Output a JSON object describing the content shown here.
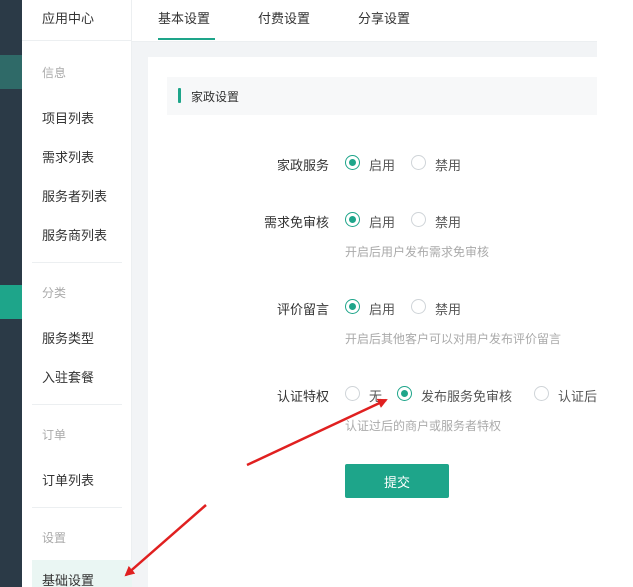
{
  "sidebar": {
    "app_title": "应用中心",
    "groups": [
      "信息",
      "分类",
      "订单",
      "设置"
    ],
    "items": [
      "项目列表",
      "需求列表",
      "服务者列表",
      "服务商列表",
      "服务类型",
      "入驻套餐",
      "订单列表",
      "基础设置"
    ]
  },
  "tabs": [
    "基本设置",
    "付费设置",
    "分享设置"
  ],
  "section_title": "家政设置",
  "rows": [
    {
      "label": "家政服务",
      "options": [
        "启用",
        "禁用"
      ],
      "selected": 0
    },
    {
      "label": "需求免审核",
      "options": [
        "启用",
        "禁用"
      ],
      "selected": 0,
      "hint": "开启后用户发布需求免审核"
    },
    {
      "label": "评价留言",
      "options": [
        "启用",
        "禁用"
      ],
      "selected": 0,
      "hint": "开启后其他客户可以对用户发布评价留言"
    },
    {
      "label": "认证特权",
      "options": [
        "无",
        "发布服务免审核",
        "认证后"
      ],
      "selected": 1,
      "hint": "认证过后的商户或服务者特权"
    }
  ],
  "submit_label": "提交",
  "colors": {
    "accent": "#1ea58a",
    "annotation": "#e02020",
    "rail": "#2b3a47"
  }
}
